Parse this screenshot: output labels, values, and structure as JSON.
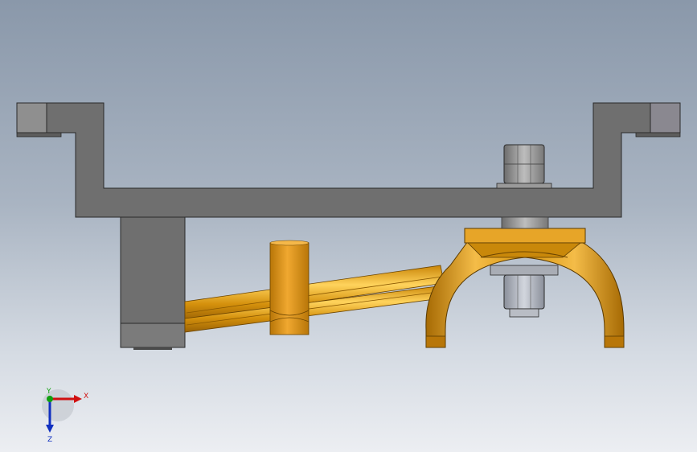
{
  "viewport": {
    "background_top": "#8a98aa",
    "background_bottom": "#eceef2"
  },
  "model": {
    "bracket_color": "#6f6f6f",
    "fork_color": "#d4900c",
    "nut_color": "#8e8e8e",
    "parts": [
      "mounting-bracket",
      "support-block",
      "shift-rod",
      "shift-fork",
      "hex-nut-top",
      "hex-nut-bottom"
    ]
  },
  "triad": {
    "x_label": "X",
    "y_label": "Y",
    "z_label": "Z",
    "x_color": "#d01010",
    "y_color": "#10a010",
    "z_color": "#1030c0"
  }
}
